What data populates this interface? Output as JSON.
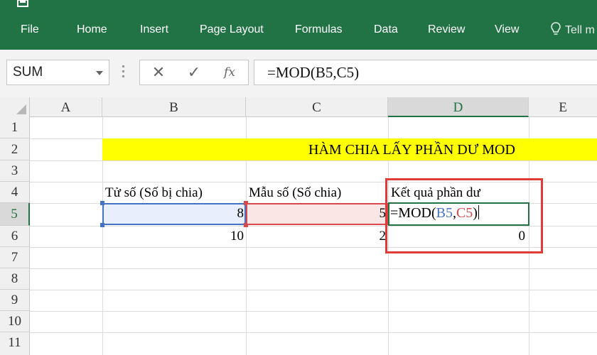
{
  "ribbon": {
    "tabs": [
      "File",
      "Home",
      "Insert",
      "Page Layout",
      "Formulas",
      "Data",
      "Review",
      "View"
    ],
    "tell_me": "Tell m",
    "accent_color": "#217346"
  },
  "formula_bar": {
    "name_box": "SUM",
    "formula": "=MOD(B5,C5)",
    "fx_label": "fx",
    "cancel_icon": "✕",
    "enter_icon": "✓"
  },
  "grid": {
    "columns": [
      "A",
      "B",
      "C",
      "D",
      "E"
    ],
    "active_column": "D",
    "rows": [
      "1",
      "2",
      "3",
      "4",
      "5",
      "6",
      "7",
      "8",
      "9",
      "10",
      "11"
    ],
    "active_row": "5"
  },
  "sheet": {
    "title": "HÀM CHIA LẤY PHẦN DƯ MOD",
    "header_b4": "Tử số (Số bị chia)",
    "header_c4": "Mẫu số (Số chia)",
    "header_d4": "Kết quả phần dư",
    "b5": "8",
    "c5": "5",
    "d5_prefix": "=MOD(",
    "d5_ref1": "B5",
    "d5_sep": ",",
    "d5_ref2": "C5",
    "d5_suffix": ")",
    "b6": "10",
    "c6": "2",
    "d6": "0"
  },
  "colors": {
    "title_fill": "#ffff00",
    "ref_b_color": "#4472c4",
    "ref_c_color": "#d9484b",
    "highlight_border": "#e03a3a"
  }
}
